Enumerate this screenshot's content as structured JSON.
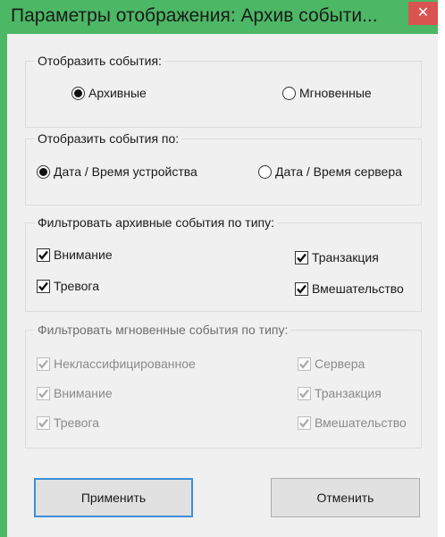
{
  "window": {
    "title": "Параметры отображения: Архив событи...",
    "close_glyph": "✕",
    "accent_color": "#4cb865"
  },
  "show_events": {
    "label": "Отобразить события:",
    "options": [
      {
        "label": "Архивные",
        "selected": true
      },
      {
        "label": "Мгновенные",
        "selected": false
      }
    ]
  },
  "show_by": {
    "label": "Отобразить события по:",
    "options": [
      {
        "label": "Дата / Время устройства",
        "selected": true
      },
      {
        "label": "Дата / Время сервера",
        "selected": false
      }
    ]
  },
  "archive_filter": {
    "label": "Фильтровать архивные события по типу:",
    "items": [
      {
        "label": "Внимание",
        "checked": true
      },
      {
        "label": "Транзакция",
        "checked": true
      },
      {
        "label": "Тревога",
        "checked": true
      },
      {
        "label": "Вмешательство",
        "checked": true
      }
    ]
  },
  "instant_filter": {
    "label": "Фильтровать мгновенные события по типу:",
    "enabled": false,
    "items": [
      {
        "label": "Неклассифицированное",
        "checked": true
      },
      {
        "label": "Сервера",
        "checked": true
      },
      {
        "label": "Внимание",
        "checked": true
      },
      {
        "label": "Транзакция",
        "checked": true
      },
      {
        "label": "Тревога",
        "checked": true
      },
      {
        "label": "Вмешательство",
        "checked": true
      }
    ]
  },
  "buttons": {
    "apply": "Применить",
    "cancel": "Отменить"
  }
}
